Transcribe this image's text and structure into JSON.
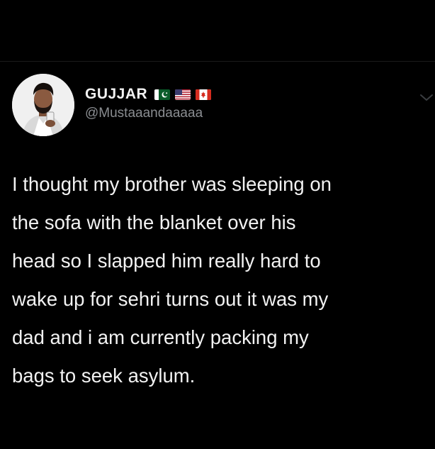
{
  "author": {
    "display_name": "GUJJAR",
    "handle": "@Mustaaandaaaaa",
    "flags": [
      {
        "country": "Pakistan",
        "icon": "pakistan-flag-icon"
      },
      {
        "country": "United States",
        "icon": "usa-flag-icon"
      },
      {
        "country": "Canada",
        "icon": "canada-flag-icon"
      }
    ]
  },
  "tweet": {
    "lines": [
      "I thought my brother was sleeping on",
      "the sofa with the blanket over his",
      "head so I slapped him really hard to",
      "wake up for sehri turns out it was my",
      "dad and i am currently packing my",
      "bags to seek asylum."
    ]
  },
  "colors": {
    "background": "#000000",
    "name": "#f2f2f2",
    "handle": "#8a8d91",
    "text": "#f2f2f2"
  },
  "icons": {
    "menu": "chevron-down-icon",
    "avatar": "avatar"
  }
}
